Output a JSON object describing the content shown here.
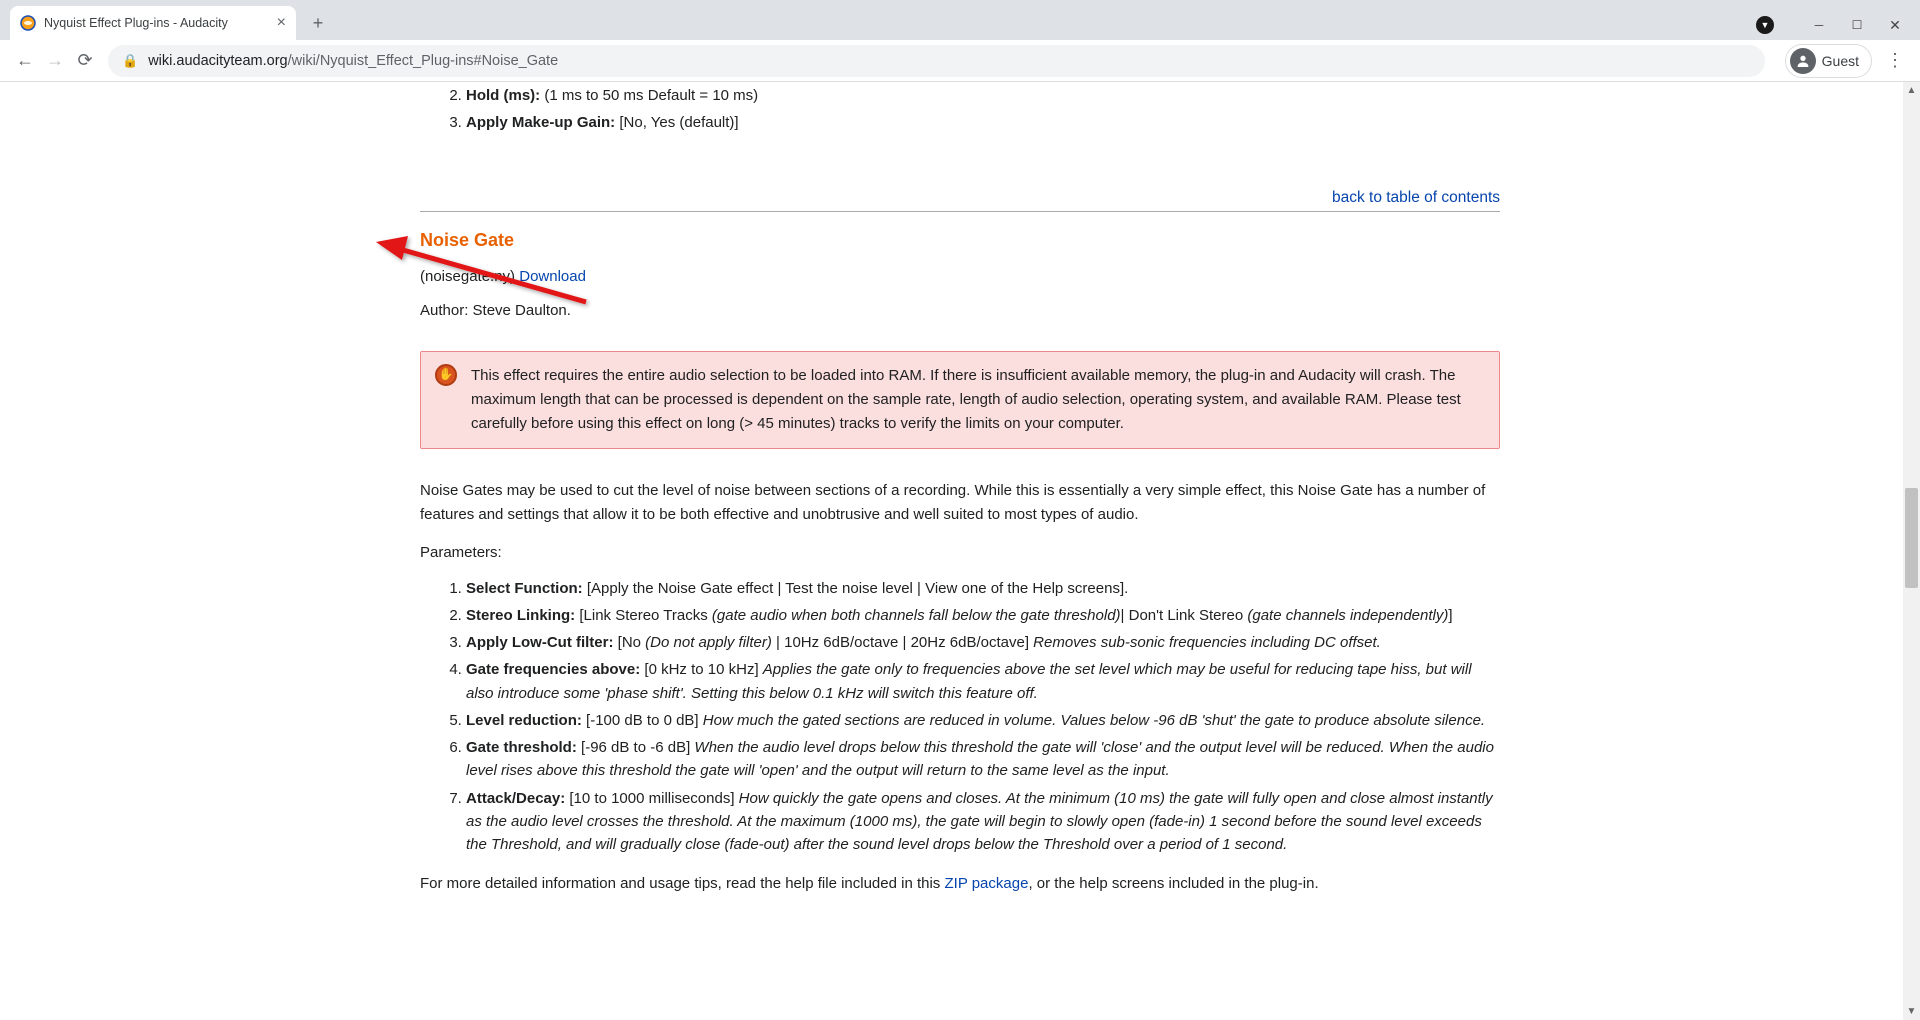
{
  "browser": {
    "tab_title": "Nyquist Effect Plug-ins - Audacity",
    "url_domain": "wiki.audacityteam.org",
    "url_path": "/wiki/Nyquist_Effect_Plug-ins#Noise_Gate",
    "guest_label": "Guest"
  },
  "pre_list": {
    "start": 2,
    "items": [
      {
        "label": "Hold (ms):",
        "rest": " (1 ms to 50 ms Default = 10 ms)"
      },
      {
        "label": "Apply Make-up Gain:",
        "rest": " [No, Yes (default)]"
      }
    ]
  },
  "back_link": "back to table of contents",
  "heading": "Noise Gate",
  "filename": "(noisegate.ny) ",
  "download": "Download",
  "author_line": "Author: Steve Daulton.",
  "warning": "This effect requires the entire audio selection to be loaded into RAM. If there is insufficient available memory, the plug-in and Audacity will crash. The maximum length that can be processed is dependent on the sample rate, length of audio selection, operating system, and available RAM. Please test carefully before using this effect on long (> 45 minutes) tracks to verify the limits on your computer.",
  "intro": "Noise Gates may be used to cut the level of noise between sections of a recording. While this is essentially a very simple effect, this Noise Gate has a number of features and settings that allow it to be both effective and unobtrusive and well suited to most types of audio.",
  "params_label": "Parameters:",
  "params": [
    {
      "label": "Select Function:",
      "plain": " [Apply the Noise Gate effect | Test the noise level | View one of the Help screens].",
      "italic": ""
    },
    {
      "label": "Stereo Linking:",
      "plain": " [Link Stereo Tracks ",
      "italic1": "(gate audio when both channels fall below the gate threshold)",
      "plain2": "| Don't Link Stereo ",
      "italic2": "(gate channels independently)",
      "plain3": "]"
    },
    {
      "label": "Apply Low-Cut filter:",
      "plain": " [No ",
      "italic1": "(Do not apply filter)",
      "plain2": " | 10Hz 6dB/octave | 20Hz 6dB/octave] ",
      "italic2": "Removes sub-sonic frequencies including DC offset."
    },
    {
      "label": "Gate frequencies above:",
      "plain": " [0 kHz to 10 kHz] ",
      "italic1": "Applies the gate only to frequencies above the set level which may be useful for reducing tape hiss, but will also introduce some 'phase shift'. Setting this below 0.1 kHz will switch this feature off."
    },
    {
      "label": "Level reduction:",
      "plain": " [-100 dB to 0 dB] ",
      "italic1": "How much the gated sections are reduced in volume. Values below -96 dB 'shut' the gate to produce absolute silence."
    },
    {
      "label": "Gate threshold:",
      "plain": " [-96 dB to -6 dB] ",
      "italic1": "When the audio level drops below this threshold the gate will 'close' and the output level will be reduced. When the audio level rises above this threshold the gate will 'open' and the output will return to the same level as the input."
    },
    {
      "label": "Attack/Decay:",
      "plain": " [10 to 1000 milliseconds] ",
      "italic1": "How quickly the gate opens and closes. At the minimum (10 ms) the gate will fully open and close almost instantly as the audio level crosses the threshold. At the maximum (1000 ms), the gate will begin to slowly open (fade-in) 1 second before the sound level exceeds the Threshold, and will gradually close (fade-out) after the sound level drops below the Threshold over a period of 1 second."
    }
  ],
  "footer_pre": "For more detailed information and usage tips, read the help file included in this ",
  "footer_link": "ZIP package",
  "footer_post": ", or the help screens included in the plug-in."
}
